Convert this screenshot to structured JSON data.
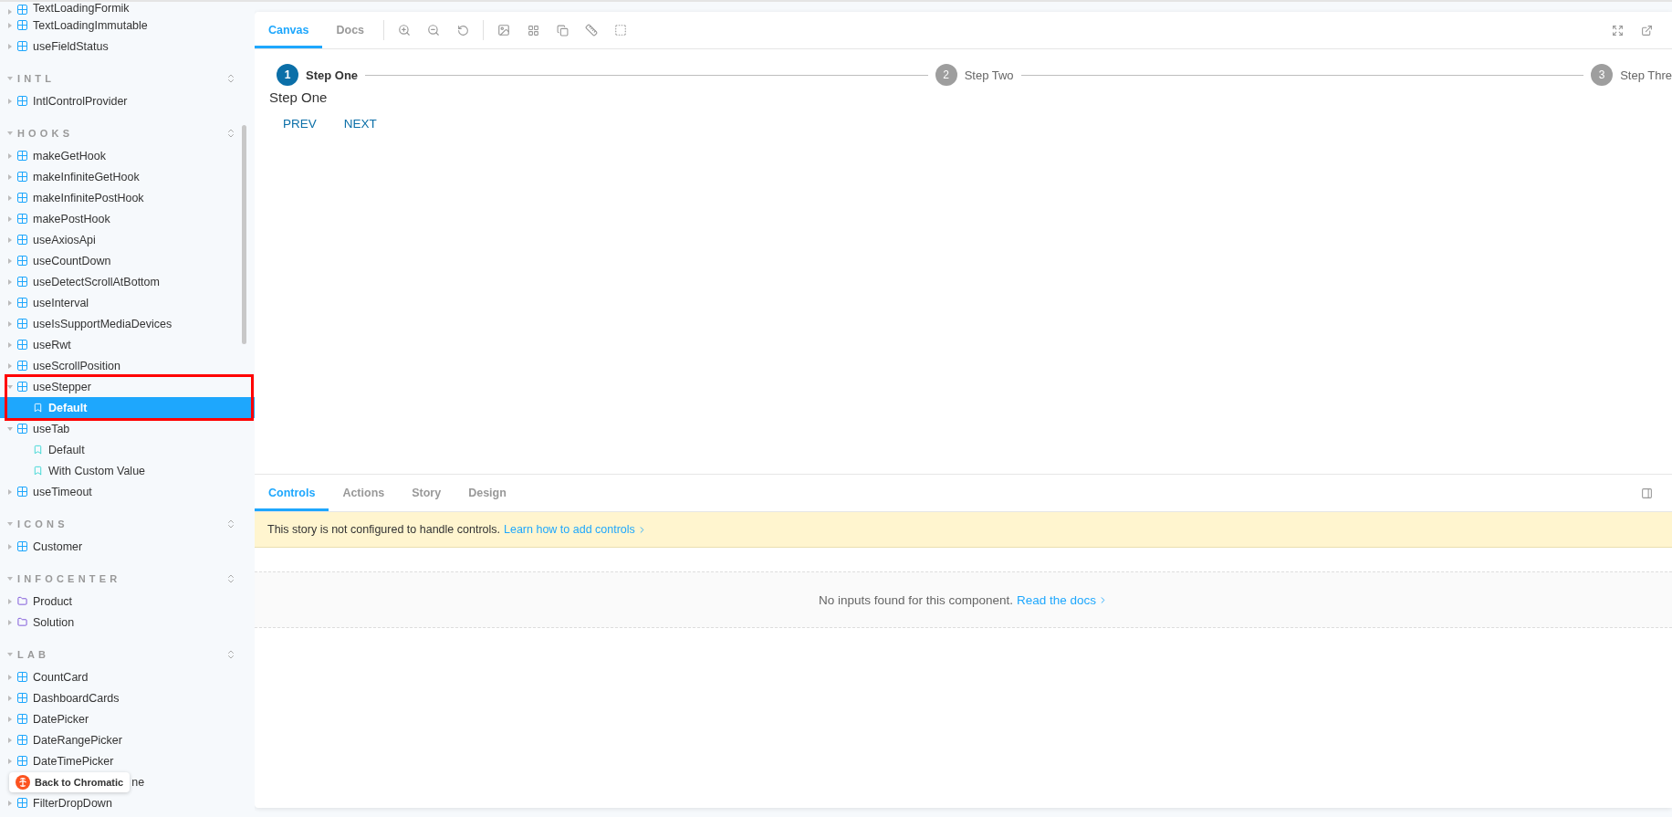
{
  "sidebar": {
    "top_items": [
      {
        "label": "TextLoadingFormik",
        "kind": "component",
        "expanded": false,
        "selected": false
      },
      {
        "label": "TextLoadingImmutable",
        "kind": "component",
        "expanded": false,
        "selected": false
      },
      {
        "label": "useFieldStatus",
        "kind": "component",
        "expanded": false,
        "selected": false
      }
    ],
    "sections": [
      {
        "title": "INTL",
        "items": [
          {
            "label": "IntlControlProvider",
            "kind": "component",
            "expanded": false,
            "selected": false
          }
        ]
      },
      {
        "title": "HOOKS",
        "items": [
          {
            "label": "makeGetHook",
            "kind": "component",
            "expanded": false,
            "selected": false
          },
          {
            "label": "makeInfiniteGetHook",
            "kind": "component",
            "expanded": false,
            "selected": false
          },
          {
            "label": "makeInfinitePostHook",
            "kind": "component",
            "expanded": false,
            "selected": false
          },
          {
            "label": "makePostHook",
            "kind": "component",
            "expanded": false,
            "selected": false
          },
          {
            "label": "useAxiosApi",
            "kind": "component",
            "expanded": false,
            "selected": false
          },
          {
            "label": "useCountDown",
            "kind": "component",
            "expanded": false,
            "selected": false
          },
          {
            "label": "useDetectScrollAtBottom",
            "kind": "component",
            "expanded": false,
            "selected": false
          },
          {
            "label": "useInterval",
            "kind": "component",
            "expanded": false,
            "selected": false
          },
          {
            "label": "useIsSupportMediaDevices",
            "kind": "component",
            "expanded": false,
            "selected": false
          },
          {
            "label": "useRwt",
            "kind": "component",
            "expanded": false,
            "selected": false
          },
          {
            "label": "useScrollPosition",
            "kind": "component",
            "expanded": false,
            "selected": false
          },
          {
            "label": "useStepper",
            "kind": "component",
            "expanded": true,
            "selected": false,
            "outlined": true,
            "children": [
              {
                "label": "Default",
                "kind": "story",
                "selected": true
              }
            ]
          },
          {
            "label": "useTab",
            "kind": "component",
            "expanded": true,
            "selected": false,
            "children": [
              {
                "label": "Default",
                "kind": "story",
                "selected": false
              },
              {
                "label": "With Custom Value",
                "kind": "story",
                "selected": false
              }
            ]
          },
          {
            "label": "useTimeout",
            "kind": "component",
            "expanded": false,
            "selected": false
          }
        ]
      },
      {
        "title": "ICONS",
        "items": [
          {
            "label": "Customer",
            "kind": "component",
            "expanded": false,
            "selected": false
          }
        ]
      },
      {
        "title": "INFOCENTER",
        "items": [
          {
            "label": "Product",
            "kind": "folder",
            "expanded": false,
            "selected": false
          },
          {
            "label": "Solution",
            "kind": "folder",
            "expanded": false,
            "selected": false
          }
        ]
      },
      {
        "title": "LAB",
        "items": [
          {
            "label": "CountCard",
            "kind": "component",
            "expanded": false,
            "selected": false
          },
          {
            "label": "DashboardCards",
            "kind": "component",
            "expanded": false,
            "selected": false
          },
          {
            "label": "DatePicker",
            "kind": "component",
            "expanded": false,
            "selected": false
          },
          {
            "label": "DateRangePicker",
            "kind": "component",
            "expanded": false,
            "selected": false
          },
          {
            "label": "DateTimePicker",
            "kind": "component",
            "expanded": false,
            "selected": false
          },
          {
            "label": "ne",
            "kind": "covered",
            "selected": false
          },
          {
            "label": "FilterDropDown",
            "kind": "component",
            "expanded": false,
            "selected": false
          }
        ]
      }
    ]
  },
  "chromatic_badge": {
    "label": "Back to Chromatic"
  },
  "toolbar": {
    "tabs": [
      {
        "label": "Canvas",
        "selected": true
      },
      {
        "label": "Docs",
        "selected": false
      }
    ]
  },
  "canvas": {
    "steps": [
      {
        "number": "1",
        "label": "Step One",
        "active": true
      },
      {
        "number": "2",
        "label": "Step Two",
        "active": false
      },
      {
        "number": "3",
        "label": "Step Thre",
        "active": false
      }
    ],
    "content": "Step One",
    "buttons": [
      "PREV",
      "NEXT"
    ]
  },
  "addons": {
    "tabs": [
      {
        "label": "Controls",
        "selected": true
      },
      {
        "label": "Actions",
        "selected": false
      },
      {
        "label": "Story",
        "selected": false
      },
      {
        "label": "Design",
        "selected": false
      }
    ],
    "banner": {
      "text": "This story is not configured to handle controls.",
      "link": "Learn how to add controls"
    },
    "empty": {
      "text": "No inputs found for this component.",
      "link": "Read the docs"
    }
  }
}
